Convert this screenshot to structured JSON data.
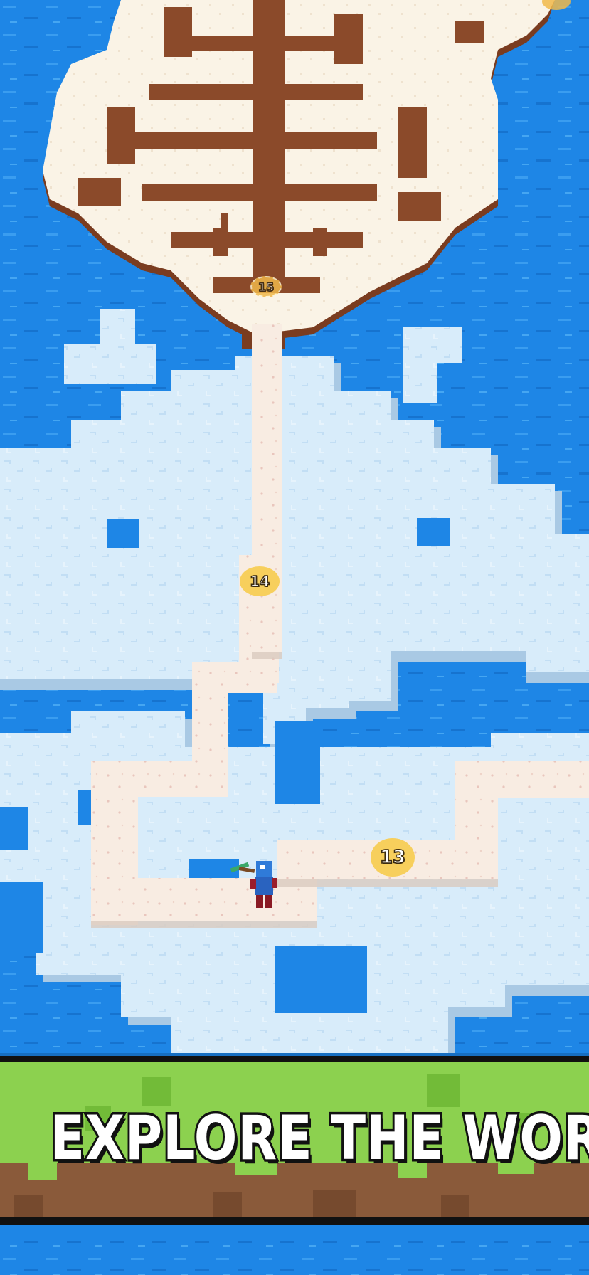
{
  "game": {
    "banner_title": "EXPLORE THE WORLD",
    "level_markers": {
      "level_15": "15",
      "level_14": "14",
      "level_13": "13",
      "level_16": ""
    }
  },
  "palette": {
    "water": "#1e86e6",
    "ice": "#d8ecfa",
    "path_sand": "#f8ece2",
    "snow": "#faf3e6",
    "dirt": "#8b4a2a",
    "grass": "#8cd14f",
    "marker_gold": "#f7cf5c"
  },
  "icons": {
    "player": "blocky-miner-character-icon",
    "tool": "pickaxe-icon"
  }
}
